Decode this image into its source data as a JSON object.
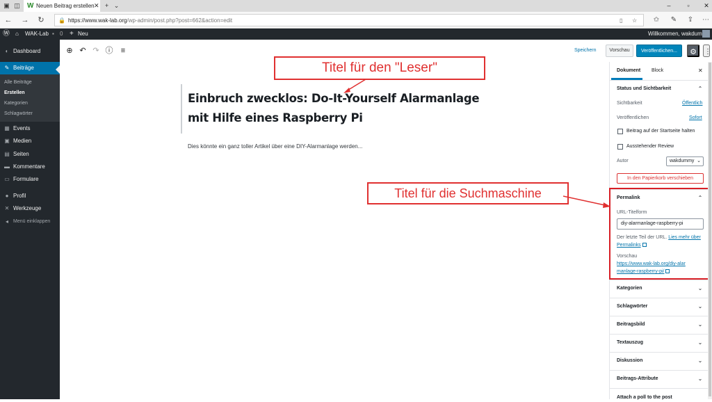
{
  "browser": {
    "tab_title": "Neuen Beitrag erstellen",
    "tab_favicon": "W",
    "url_host": "https://www.wak-lab.org",
    "url_path": "/wp-admin/post.php?post=662&action=edit"
  },
  "adminbar": {
    "site_name": "WAK-Lab",
    "comments_count": "0",
    "new_label": "Neu",
    "welcome": "Willkommen, wakdummy"
  },
  "sidebar": {
    "items": [
      {
        "label": "Dashboard",
        "icon": "dashboard-icon"
      },
      {
        "label": "Beiträge",
        "icon": "pin-icon"
      },
      {
        "label": "Events",
        "icon": "calendar-icon"
      },
      {
        "label": "Medien",
        "icon": "media-icon"
      },
      {
        "label": "Seiten",
        "icon": "pages-icon"
      },
      {
        "label": "Kommentare",
        "icon": "comment-icon"
      },
      {
        "label": "Formulare",
        "icon": "forms-icon"
      },
      {
        "label": "Profil",
        "icon": "user-icon"
      },
      {
        "label": "Werkzeuge",
        "icon": "wrench-icon"
      },
      {
        "label": "Menü einklappen",
        "icon": "collapse-icon"
      }
    ],
    "submenu": [
      "Alle Beiträge",
      "Erstellen",
      "Kategorien",
      "Schlagwörter"
    ]
  },
  "editor": {
    "save_draft": "Speichern",
    "preview": "Vorschau",
    "publish": "Veröffentlichen...",
    "post_title": "Einbruch zwecklos: Do-It-Yourself Alarmanlage mit Hilfe eines Raspberry Pi",
    "post_body": "Dies könnte ein ganz toller Artikel über eine DIY-Alarmanlage werden..."
  },
  "panel": {
    "tab_document": "Dokument",
    "tab_block": "Block",
    "status_heading": "Status und Sichtbarkeit",
    "visibility_label": "Sichtbarkeit",
    "visibility_value": "Öffentlich",
    "publish_label": "Veröffentlichen",
    "publish_value": "Sofort",
    "sticky_label": "Beitrag auf der Startseite halten",
    "pending_label": "Ausstehender Review",
    "author_label": "Autor",
    "author_value": "wakdummy",
    "trash_label": "In den Papierkorb verschieben",
    "permalink_heading": "Permalink",
    "url_slug_label": "URL-Titelform",
    "url_slug_value": "diy-alarmanlage-raspberry-pi",
    "slug_help": "Der letzte Teil der URL.",
    "slug_help_link": "Lies mehr über Permalinks",
    "preview_label": "Vorschau",
    "preview_url": "https://www.wak-lab.org/diy-alarmanlage-raspberry-pi/",
    "sections": [
      "Kategorien",
      "Schlagwörter",
      "Beitragsbild",
      "Textauszug",
      "Diskussion",
      "Beitrags-Attribute",
      "Attach a poll to the post"
    ]
  },
  "annotations": {
    "reader_title": "Titel für den \"Leser\"",
    "search_title": "Titel für die Suchmaschine",
    "color": "#e03030"
  }
}
